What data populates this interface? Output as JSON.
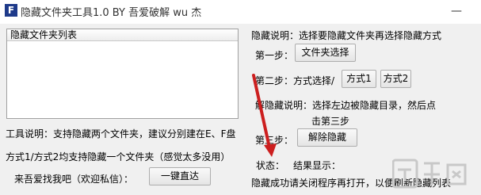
{
  "window": {
    "title": "隐藏文件夹工具1.0 BY 吾爱破解 wu 杰",
    "icon_letter": "F",
    "minimize_glyph": "—"
  },
  "list": {
    "header": "隐藏文件夹列表"
  },
  "right": {
    "note": "隐藏说明：选择要隐藏文件夹再选择隐藏方式",
    "step1_label": "第一步：",
    "step1_button": "文件夹选择",
    "step2_label": "第二步：方式选择/",
    "mode1_button": "方式1",
    "mode2_button": "方式2",
    "unhide_note": "解隐藏说明：选择左边被隐藏目录，然后点",
    "unhide_note2": "击第三步",
    "step3_label": "第三步：",
    "step3_button": "解除隐藏",
    "status_label": "状态：",
    "result_label": "结果显示：",
    "footer_msg": "隐藏成功请关闭程序再打开，以便刷新隐藏列表"
  },
  "left": {
    "tool_note": "工具说明：支持隐藏两个文件夹，建议分别建在E、F盘",
    "mode_note": "方式1/方式2均支持隐藏一个文件夹（感觉太多没用）",
    "contact_label": "来吾爱找我吧（欢迎私信）：",
    "direct_button": "一键直达"
  },
  "colors": {
    "arrow": "#cc1f1f",
    "icon_bg": "#1e3a8a",
    "background": "#f0f0f0"
  }
}
